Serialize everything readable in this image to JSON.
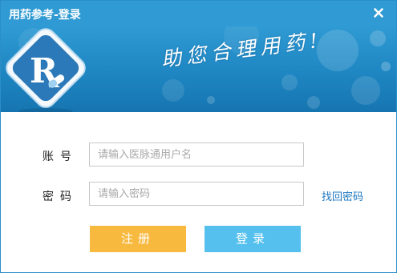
{
  "window": {
    "title": "用药参考-登录",
    "close_glyph": "×"
  },
  "banner": {
    "logo_icon": "rx-logo-icon",
    "slogan": "助您合理用药!"
  },
  "form": {
    "account_label": "账号",
    "account_placeholder": "请输入医脉通用户名",
    "account_value": "",
    "password_label": "密码",
    "password_placeholder": "请输入密码",
    "password_value": "",
    "forgot_password_link": "找回密码"
  },
  "buttons": {
    "register": "注册",
    "login": "登录"
  },
  "colors": {
    "titlebar": "#2f9ad3",
    "banner": "#1e86c2",
    "register_button": "#f8b93f",
    "login_button": "#55c0ee",
    "link": "#1f78c1"
  }
}
